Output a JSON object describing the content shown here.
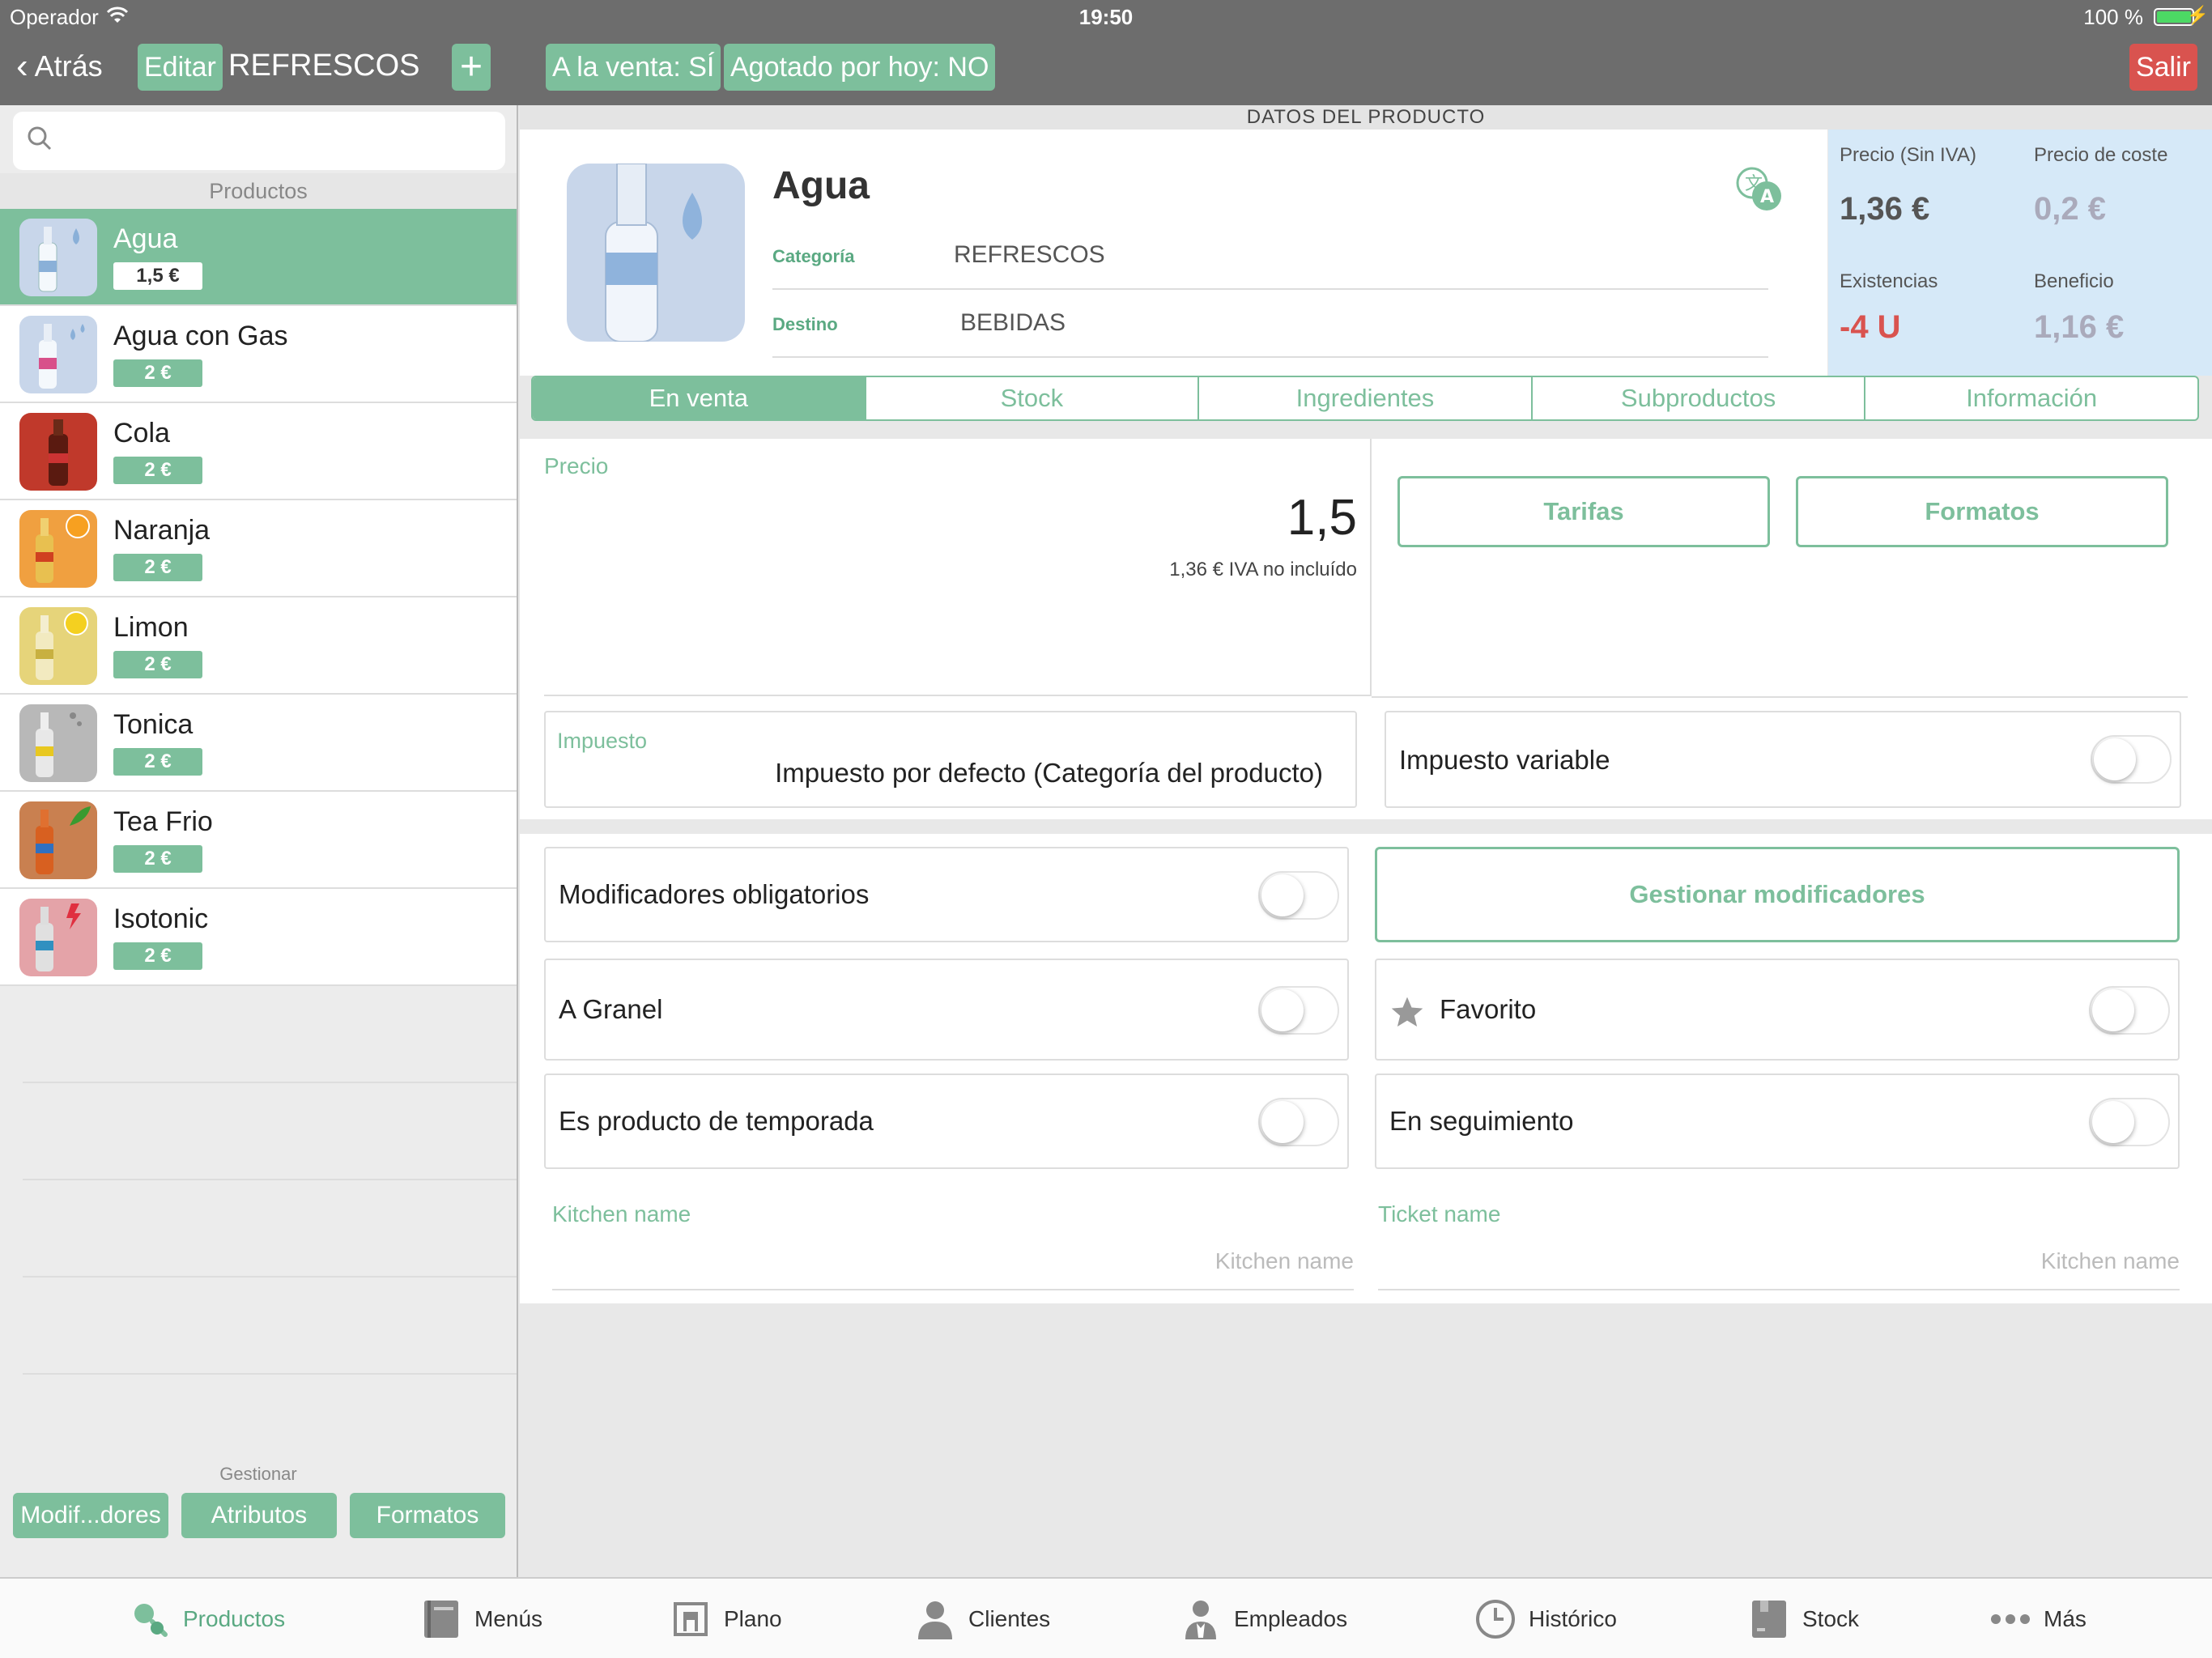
{
  "status_bar": {
    "carrier": "Operador",
    "time": "19:50",
    "battery": "100 %"
  },
  "nav": {
    "back_label": "Atrás",
    "edit_label": "Editar",
    "title": "REFRESCOS",
    "add_label": "+",
    "on_sale": "A la venta: SÍ",
    "sold_out": "Agotado por hoy: NO",
    "exit_label": "Salir"
  },
  "sidebar": {
    "search_placeholder": "",
    "section_title": "Productos",
    "products": [
      {
        "name": "Agua",
        "price": "1,5 €",
        "color": "#c8d6ea",
        "selected": true
      },
      {
        "name": "Agua con Gas",
        "price": "2 €",
        "color": "#c8d6ea"
      },
      {
        "name": "Cola",
        "price": "2 €",
        "color": "#c0392b"
      },
      {
        "name": "Naranja",
        "price": "2 €",
        "color": "#f0a040"
      },
      {
        "name": "Limon",
        "price": "2 €",
        "color": "#e6d47a"
      },
      {
        "name": "Tonica",
        "price": "2 €",
        "color": "#b8b8b8"
      },
      {
        "name": "Tea Frio",
        "price": "2 €",
        "color": "#c98050"
      },
      {
        "name": "Isotonic",
        "price": "2 €",
        "color": "#e4a3a8"
      }
    ],
    "manage_label": "Gestionar",
    "manage_buttons": [
      "Modif...dores",
      "Atributos",
      "Formatos"
    ]
  },
  "product": {
    "section_header": "DATOS DEL PRODUCTO",
    "name": "Agua",
    "category_label": "Categoría",
    "category_value": "REFRESCOS",
    "destination_label": "Destino",
    "destination_value": "BEBIDAS"
  },
  "stats": {
    "price_label": "Precio (Sin IVA)",
    "price_value": "1,36 €",
    "cost_label": "Precio de coste",
    "cost_value": "0,2 €",
    "stock_label": "Existencias",
    "stock_value": "-4 U",
    "profit_label": "Beneficio",
    "profit_value": "1,16 €"
  },
  "tabs": [
    "En venta",
    "Stock",
    "Ingredientes",
    "Subproductos",
    "Información"
  ],
  "form": {
    "price_label": "Precio",
    "price_value": "1,5",
    "price_note": "1,36 € IVA no incluído",
    "rates_button": "Tarifas",
    "formats_button": "Formatos",
    "tax_label": "Impuesto",
    "tax_value": "Impuesto por defecto (Categoría del producto)",
    "variable_tax": "Impuesto variable",
    "mandatory_modifiers": "Modificadores obligatorios",
    "manage_modifiers": "Gestionar modificadores",
    "bulk": "A Granel",
    "favorite": "Favorito",
    "seasonal": "Es producto de temporada",
    "tracking": "En seguimiento",
    "kitchen_name_label": "Kitchen name",
    "kitchen_name_placeholder": "Kitchen name",
    "ticket_name_label": "Ticket name",
    "ticket_name_placeholder": "Kitchen name"
  },
  "tabbar": [
    "Productos",
    "Menús",
    "Plano",
    "Clientes",
    "Empleados",
    "Histórico",
    "Stock",
    "Más"
  ]
}
